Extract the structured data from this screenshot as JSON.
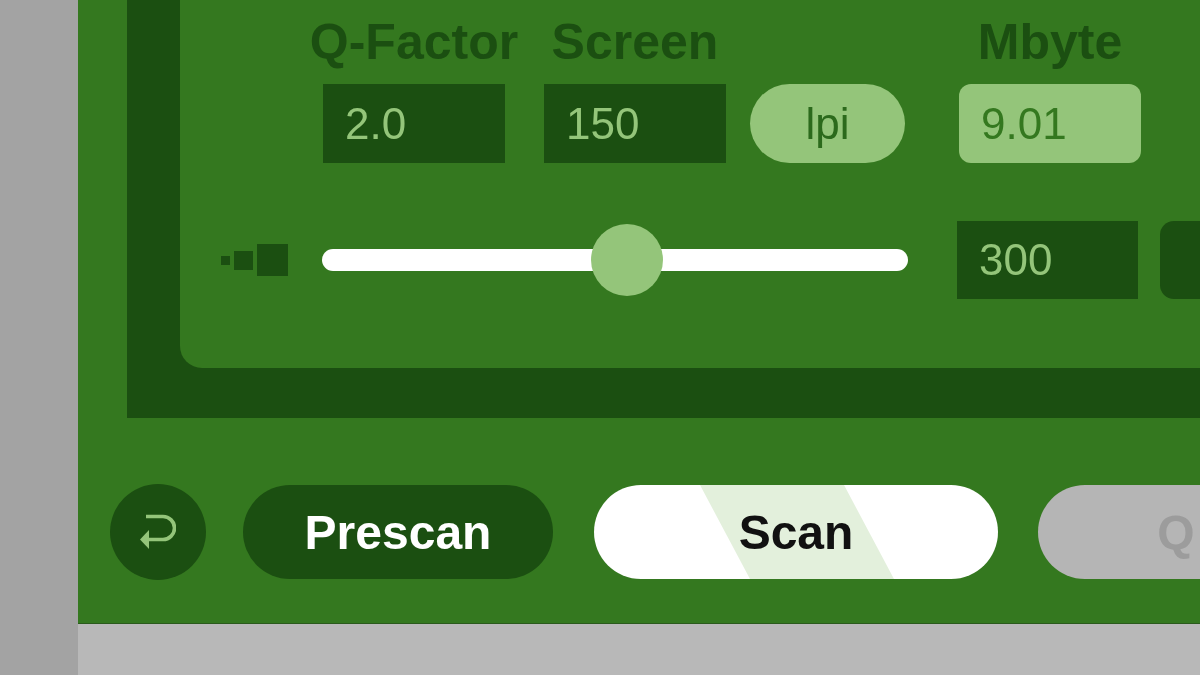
{
  "fields": [
    {
      "kind": "field",
      "label": "Q-Factor",
      "value": "2.0",
      "readonly": false
    },
    {
      "kind": "field",
      "label": "Screen",
      "value": "150",
      "readonly": false
    },
    {
      "kind": "button",
      "label": "lpi"
    },
    {
      "kind": "field",
      "label": "Mbyte",
      "value": "9.01",
      "readonly": true
    }
  ],
  "slider": {
    "level": 0.52,
    "value": "300"
  },
  "buttons": [
    {
      "kind": "icon",
      "disabled": false
    },
    {
      "kind": "secondary",
      "label": "Prescan",
      "disabled": false
    },
    {
      "kind": "primary",
      "label": "Scan",
      "disabled": false
    },
    {
      "kind": "secondary",
      "label": "Q",
      "disabled": true
    }
  ]
}
